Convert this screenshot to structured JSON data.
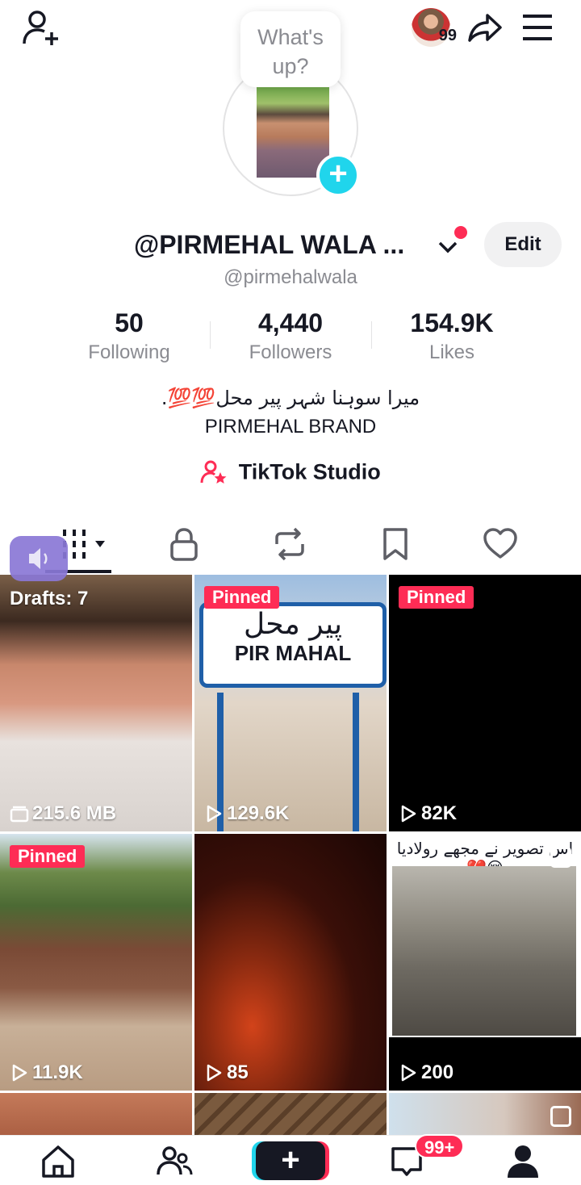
{
  "bubble": {
    "text": "What's up?"
  },
  "top": {
    "avatar_badge": "99"
  },
  "profile": {
    "display_name": "@PIRMEHAL WALA ...",
    "username": "@pirmehalwala",
    "edit_label": "Edit",
    "bio_line1": "میرا سوہنا شہر پیر محل💯💯.",
    "bio_line2": "PIRMEHAL BRAND",
    "studio_label": "TikTok Studio"
  },
  "stats": [
    {
      "value": "50",
      "label": "Following"
    },
    {
      "value": "4,440",
      "label": "Followers"
    },
    {
      "value": "154.9K",
      "label": "Likes"
    }
  ],
  "grid": [
    {
      "top_label": "Drafts: 7",
      "bottom": "215.6 MB"
    },
    {
      "pinned": "Pinned",
      "sign_urdu": "پیر محل",
      "sign_text": "PIR MAHAL",
      "views": "129.6K"
    },
    {
      "pinned": "Pinned",
      "views": "82K"
    },
    {
      "pinned": "Pinned",
      "views": "11.9K"
    },
    {
      "views": "85"
    },
    {
      "caption": "اس تصویر نے مجھے رولادیا😢💔",
      "views": "200"
    }
  ],
  "nav": {
    "inbox_badge": "99+"
  },
  "colors": {
    "accent_red": "#fe2c55",
    "accent_cyan": "#20d5ec"
  }
}
